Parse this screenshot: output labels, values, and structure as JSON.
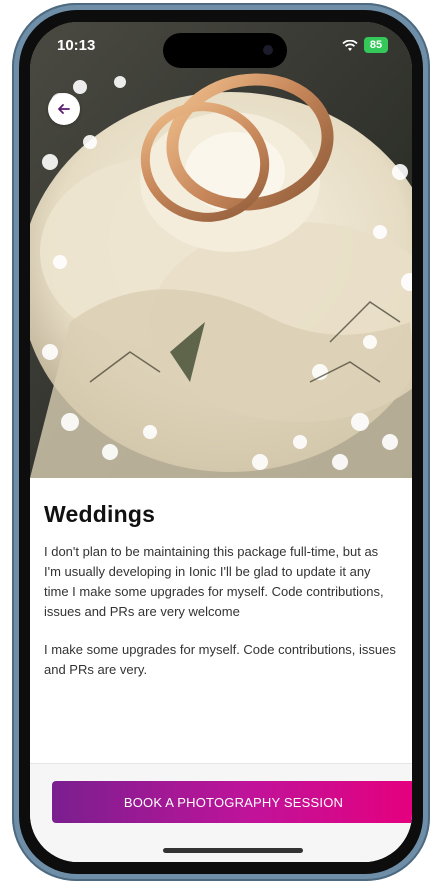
{
  "status_bar": {
    "time": "10:13",
    "battery": "85"
  },
  "detail": {
    "title": "Weddings",
    "paragraph_1": "I don't plan to be maintaining this package full-time, but as I'm usually developing in Ionic I'll be glad to update it any time I make some upgrades for myself. Code contributions, issues and PRs are very welcome",
    "paragraph_2": "I make some upgrades for myself. Code contributions, issues and PRs are very."
  },
  "footer": {
    "book_label": "BOOK A PHOTOGRAPHY SESSION"
  },
  "icons": {
    "back": "arrow-left-icon",
    "wifi": "wifi-icon"
  },
  "colors": {
    "button_gradient_start": "#7a1f8f",
    "button_gradient_end": "#e5007e",
    "battery": "#34c759"
  }
}
